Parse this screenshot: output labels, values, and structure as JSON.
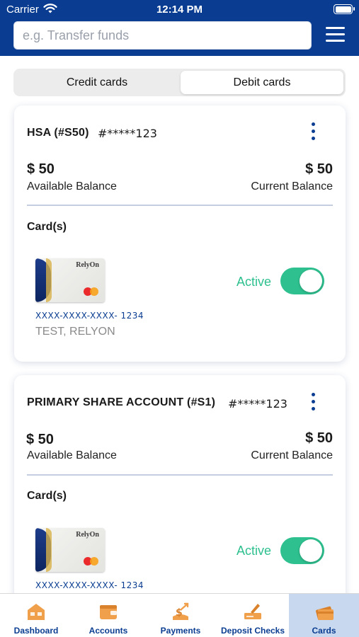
{
  "status_bar": {
    "carrier": "Carrier",
    "time": "12:14 PM"
  },
  "search": {
    "placeholder": "e.g. Transfer funds"
  },
  "segments": {
    "credit": "Credit cards",
    "debit": "Debit cards",
    "selected": "Debit cards"
  },
  "accounts": [
    {
      "name": "HSA (#S50)",
      "number": "#*****123",
      "available_amount": "$ 50",
      "available_label": "Available Balance",
      "current_amount": "$ 50",
      "current_label": "Current Balance",
      "cards_heading": "Card(s)",
      "card": {
        "brand": "RelyOn",
        "number": "XXXX-XXXX-XXXX- 1234",
        "holder": "TEST, RELYON",
        "status": "Active",
        "enabled": true
      }
    },
    {
      "name": "PRIMARY SHARE ACCOUNT (#S1)",
      "number": "#*****123",
      "available_amount": "$ 50",
      "available_label": "Available Balance",
      "current_amount": "$ 50",
      "current_label": "Current Balance",
      "cards_heading": "Card(s)",
      "card": {
        "brand": "RelyOn",
        "number": "XXXX-XXXX-XXXX- 1234",
        "status": "Active",
        "enabled": true
      }
    }
  ],
  "tabbar": [
    {
      "label": "Dashboard",
      "icon": "dashboard-icon"
    },
    {
      "label": "Accounts",
      "icon": "wallet-icon"
    },
    {
      "label": "Payments",
      "icon": "payments-icon"
    },
    {
      "label": "Deposit Checks",
      "icon": "deposit-check-icon"
    },
    {
      "label": "Cards",
      "icon": "credit-card-icon",
      "selected": true
    }
  ],
  "colors": {
    "brand": "#0a3d91",
    "active": "#2ec08f",
    "icon_orange": "#f0a04b",
    "tab_selected_bg": "#c7d8ef"
  }
}
